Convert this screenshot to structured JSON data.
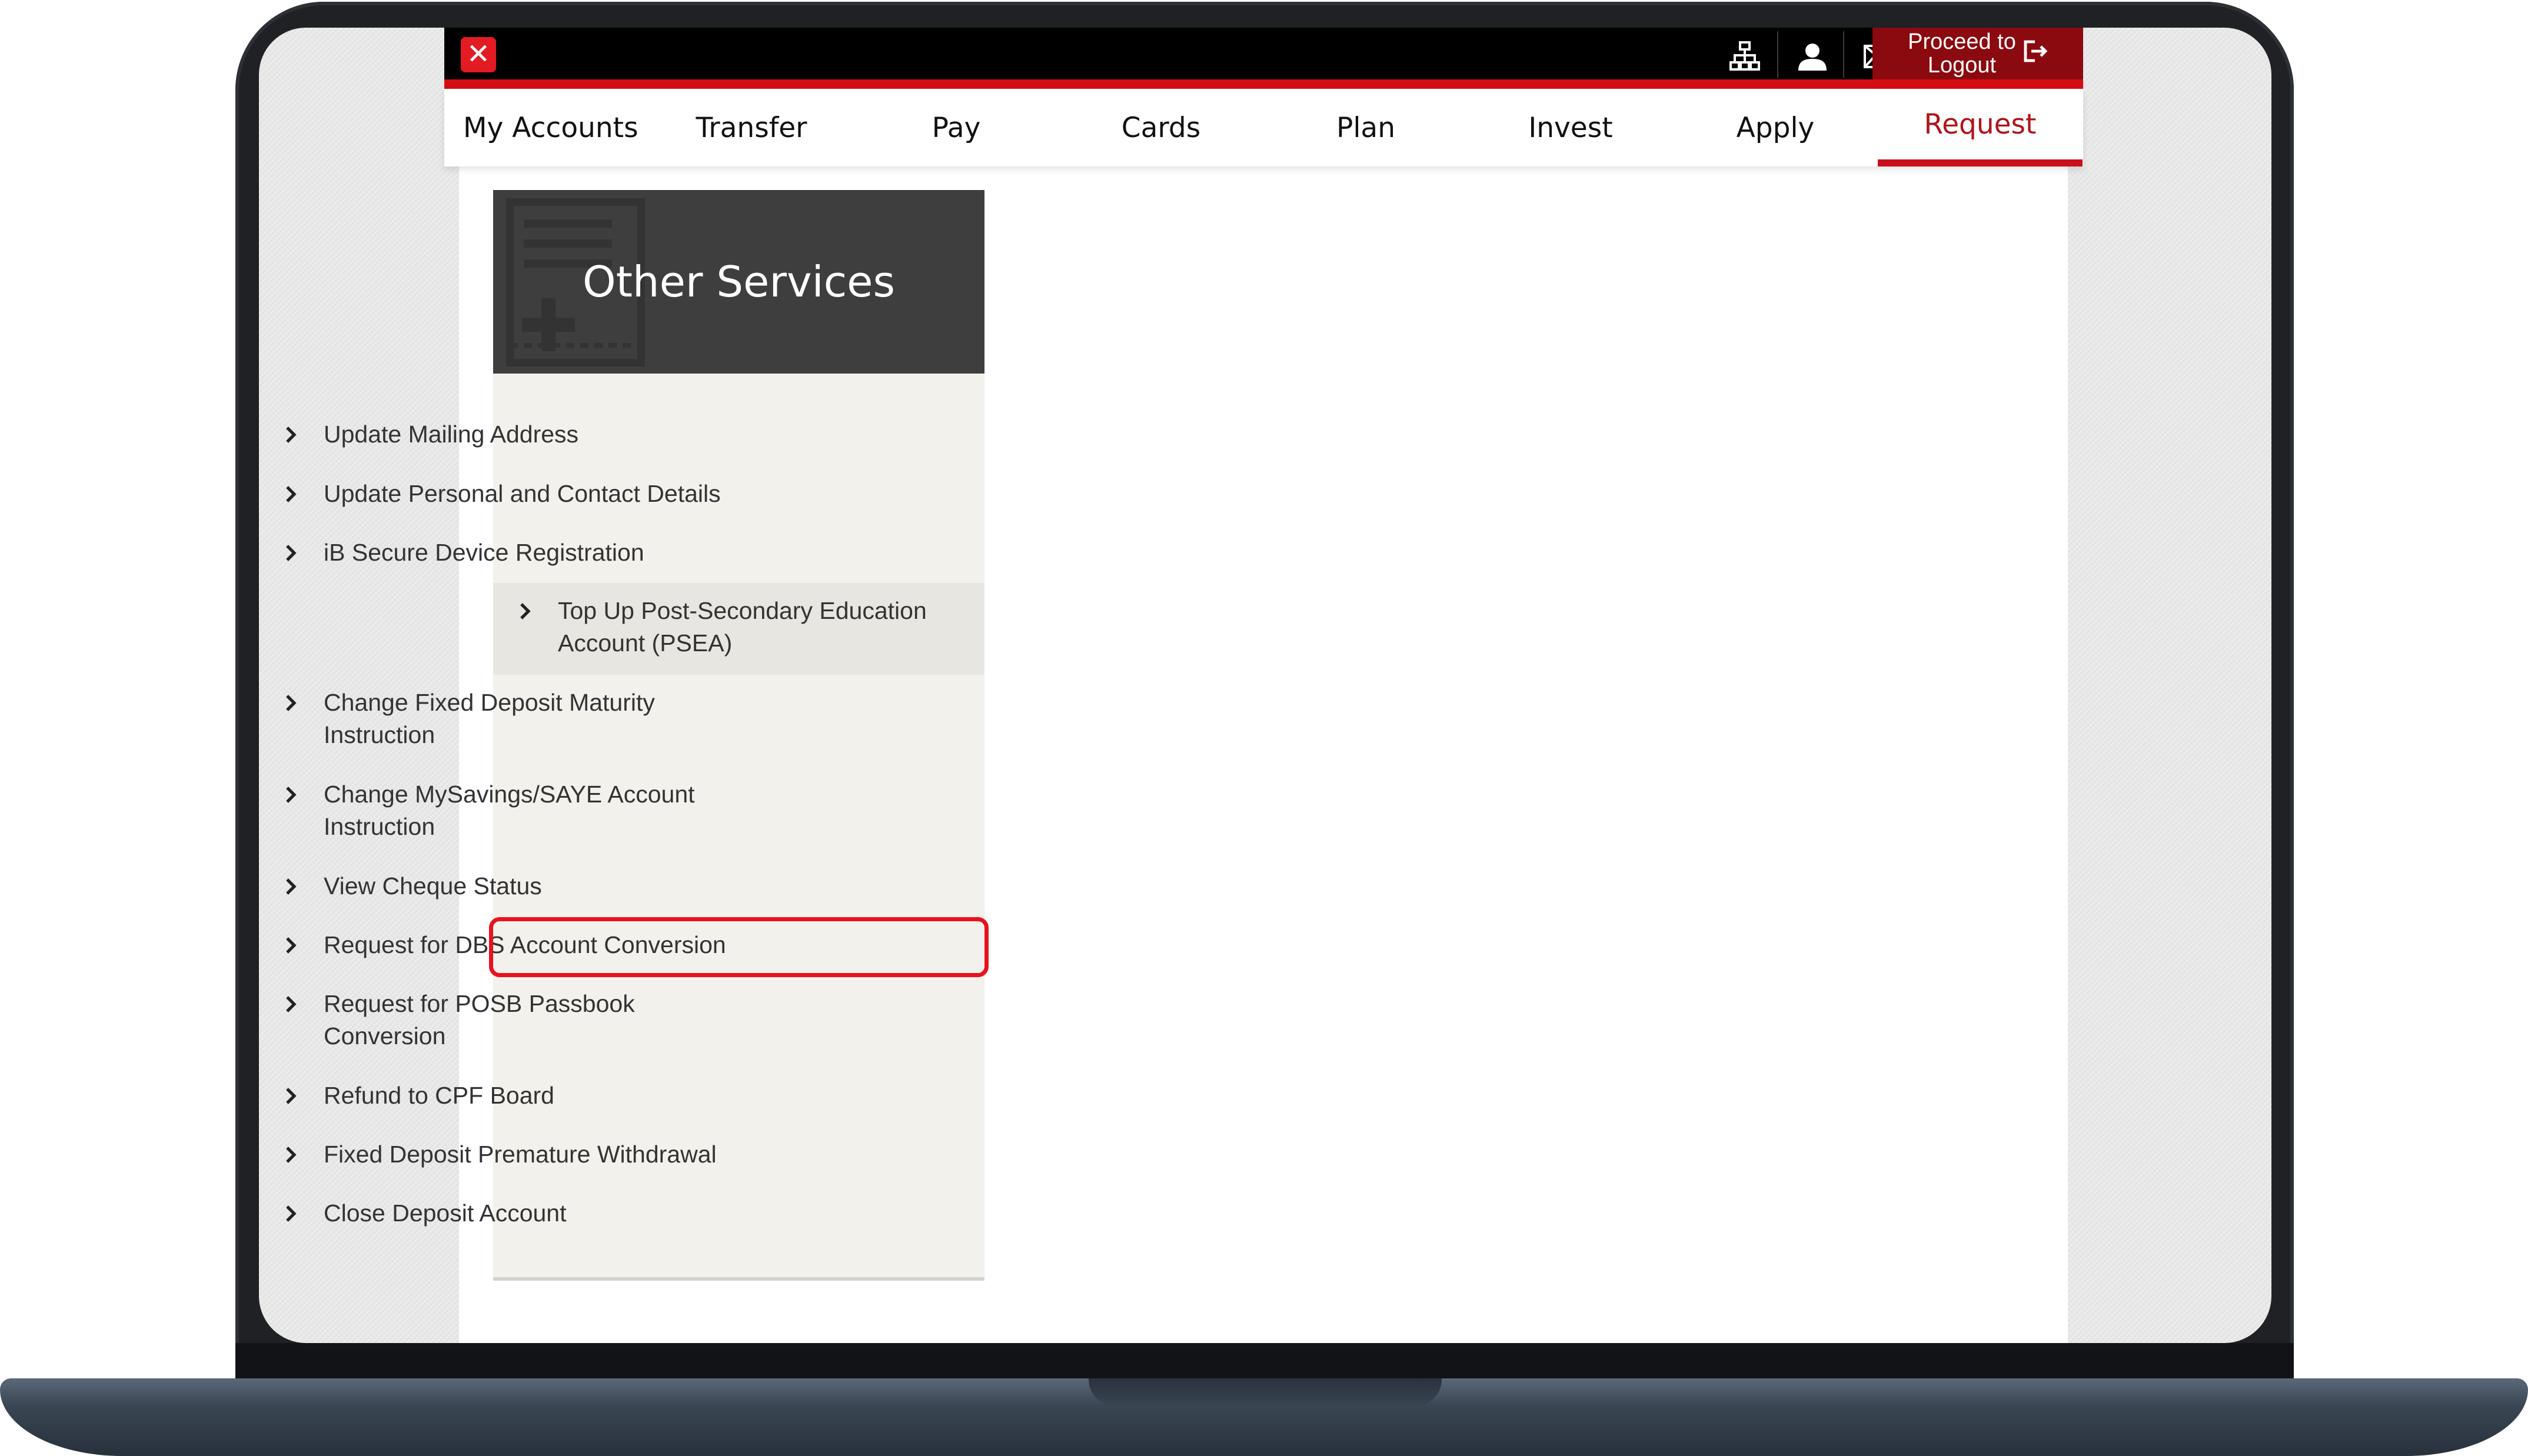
{
  "app": {
    "logo_glyph": "✕",
    "brand_color": "#e31b23",
    "accent_color": "#c8101a"
  },
  "topbar": {
    "icons": [
      "sitemap-icon",
      "user-icon",
      "mail-icon",
      "search-icon"
    ],
    "logout_line1": "Proceed to",
    "logout_line2": "Logout"
  },
  "nav": {
    "items": [
      {
        "label": "My Accounts"
      },
      {
        "label": "Transfer"
      },
      {
        "label": "Pay"
      },
      {
        "label": "Cards"
      },
      {
        "label": "Plan"
      },
      {
        "label": "Invest"
      },
      {
        "label": "Apply"
      },
      {
        "label": "Request",
        "active": true
      }
    ]
  },
  "sidebar": {
    "title": "Other Services",
    "items": [
      {
        "line1": "Update Mailing Address"
      },
      {
        "line1": "Update Personal and Contact Details"
      },
      {
        "line1": "iB Secure Device Registration"
      },
      {
        "line1": "Top Up Post-Secondary Education",
        "line2": "Account (PSEA)",
        "hovered": true
      },
      {
        "line1": "Change Fixed Deposit Maturity",
        "line2": "Instruction"
      },
      {
        "line1": "Change MySavings/SAYE Account",
        "line2": "Instruction"
      },
      {
        "line1": "View Cheque Status"
      },
      {
        "line1": "Request for DBS Account Conversion",
        "highlighted": true
      },
      {
        "line1": "Request for POSB Passbook",
        "line2": "Conversion"
      },
      {
        "line1": "Refund to CPF Board"
      },
      {
        "line1": "Fixed Deposit Premature Withdrawal"
      },
      {
        "line1": "Close Deposit Account"
      }
    ]
  }
}
